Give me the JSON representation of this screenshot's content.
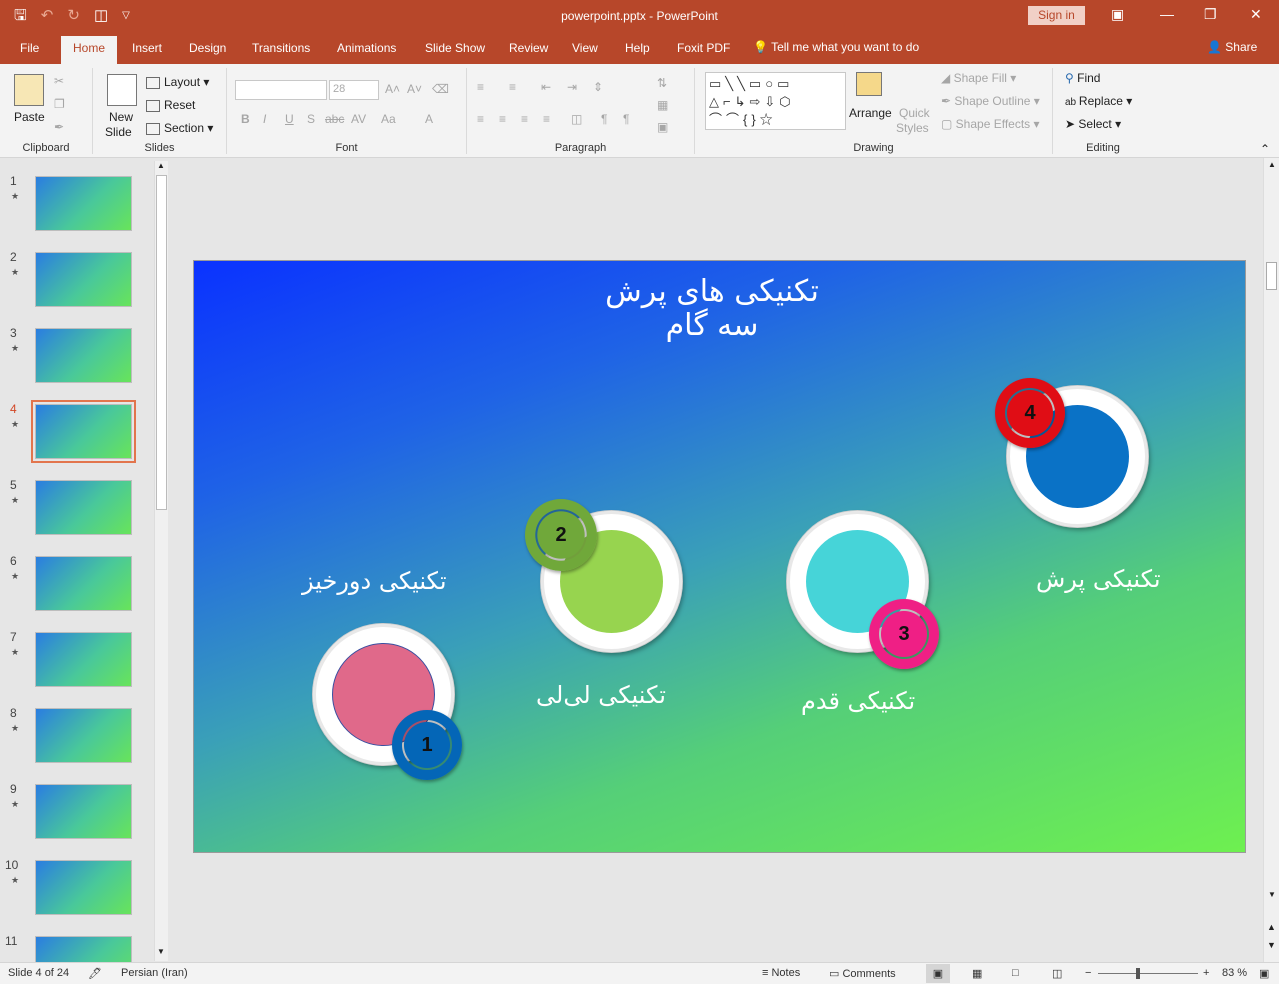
{
  "app": {
    "title": "powerpoint.pptx  -  PowerPoint",
    "signin": "Sign in",
    "qat_icons": [
      "save-icon",
      "undo-icon",
      "redo-icon",
      "present-icon",
      "customize-qat-icon"
    ]
  },
  "tabs": [
    "File",
    "Home",
    "Insert",
    "Design",
    "Transitions",
    "Animations",
    "Slide Show",
    "Review",
    "View",
    "Help",
    "Foxit PDF"
  ],
  "active_tab": "Home",
  "tellme": "Tell me what you want to do",
  "share": "Share",
  "ribbon": {
    "clipboard": {
      "label": "Clipboard",
      "paste": "Paste"
    },
    "slides": {
      "label": "Slides",
      "new_slide_1": "New",
      "new_slide_2": "Slide",
      "layout": "Layout",
      "reset": "Reset",
      "section": "Section"
    },
    "font": {
      "label": "Font",
      "size": "28",
      "format_buttons": [
        "B",
        "I",
        "U",
        "S",
        "abc",
        "AV",
        "Aa",
        "A"
      ]
    },
    "paragraph": {
      "label": "Paragraph"
    },
    "drawing": {
      "label": "Drawing",
      "arrange": "Arrange",
      "quick_styles_1": "Quick",
      "quick_styles_2": "Styles",
      "shape_fill": "Shape Fill",
      "shape_outline": "Shape Outline",
      "shape_effects": "Shape Effects"
    },
    "editing": {
      "label": "Editing",
      "find": "Find",
      "replace": "Replace",
      "select": "Select"
    }
  },
  "thumbnails": [
    {
      "num": "1",
      "star": "★"
    },
    {
      "num": "2",
      "star": "★"
    },
    {
      "num": "3",
      "star": "★"
    },
    {
      "num": "4",
      "star": "★"
    },
    {
      "num": "5",
      "star": "★"
    },
    {
      "num": "6",
      "star": "★"
    },
    {
      "num": "7",
      "star": "★"
    },
    {
      "num": "8",
      "star": "★"
    },
    {
      "num": "9",
      "star": "★"
    },
    {
      "num": "10",
      "star": "★"
    },
    {
      "num": "11",
      "star": ""
    }
  ],
  "active_slide": 4,
  "slide": {
    "title_line1": "تکنیکی های  پرش",
    "title_line2": "سه گام",
    "items": [
      {
        "num": "1",
        "label": "تکنیکی دورخیز",
        "inner_color": "#e0698a",
        "badge_color": "#0466b7"
      },
      {
        "num": "2",
        "label": "تکنیکی لی‌لی",
        "inner_color": "#97d44f",
        "badge_color": "#70a83a"
      },
      {
        "num": "3",
        "label": "تکنیکی قدم",
        "inner_color": "#46d4d8",
        "badge_color": "#ef1f85"
      },
      {
        "num": "4",
        "label": "تکنیکی پرش",
        "inner_color": "#0a72c6",
        "badge_color": "#e00d15"
      }
    ]
  },
  "status": {
    "slide_info": "Slide 4 of 24",
    "language": "Persian (Iran)",
    "notes": "Notes",
    "comments": "Comments",
    "zoom": "83 %"
  }
}
